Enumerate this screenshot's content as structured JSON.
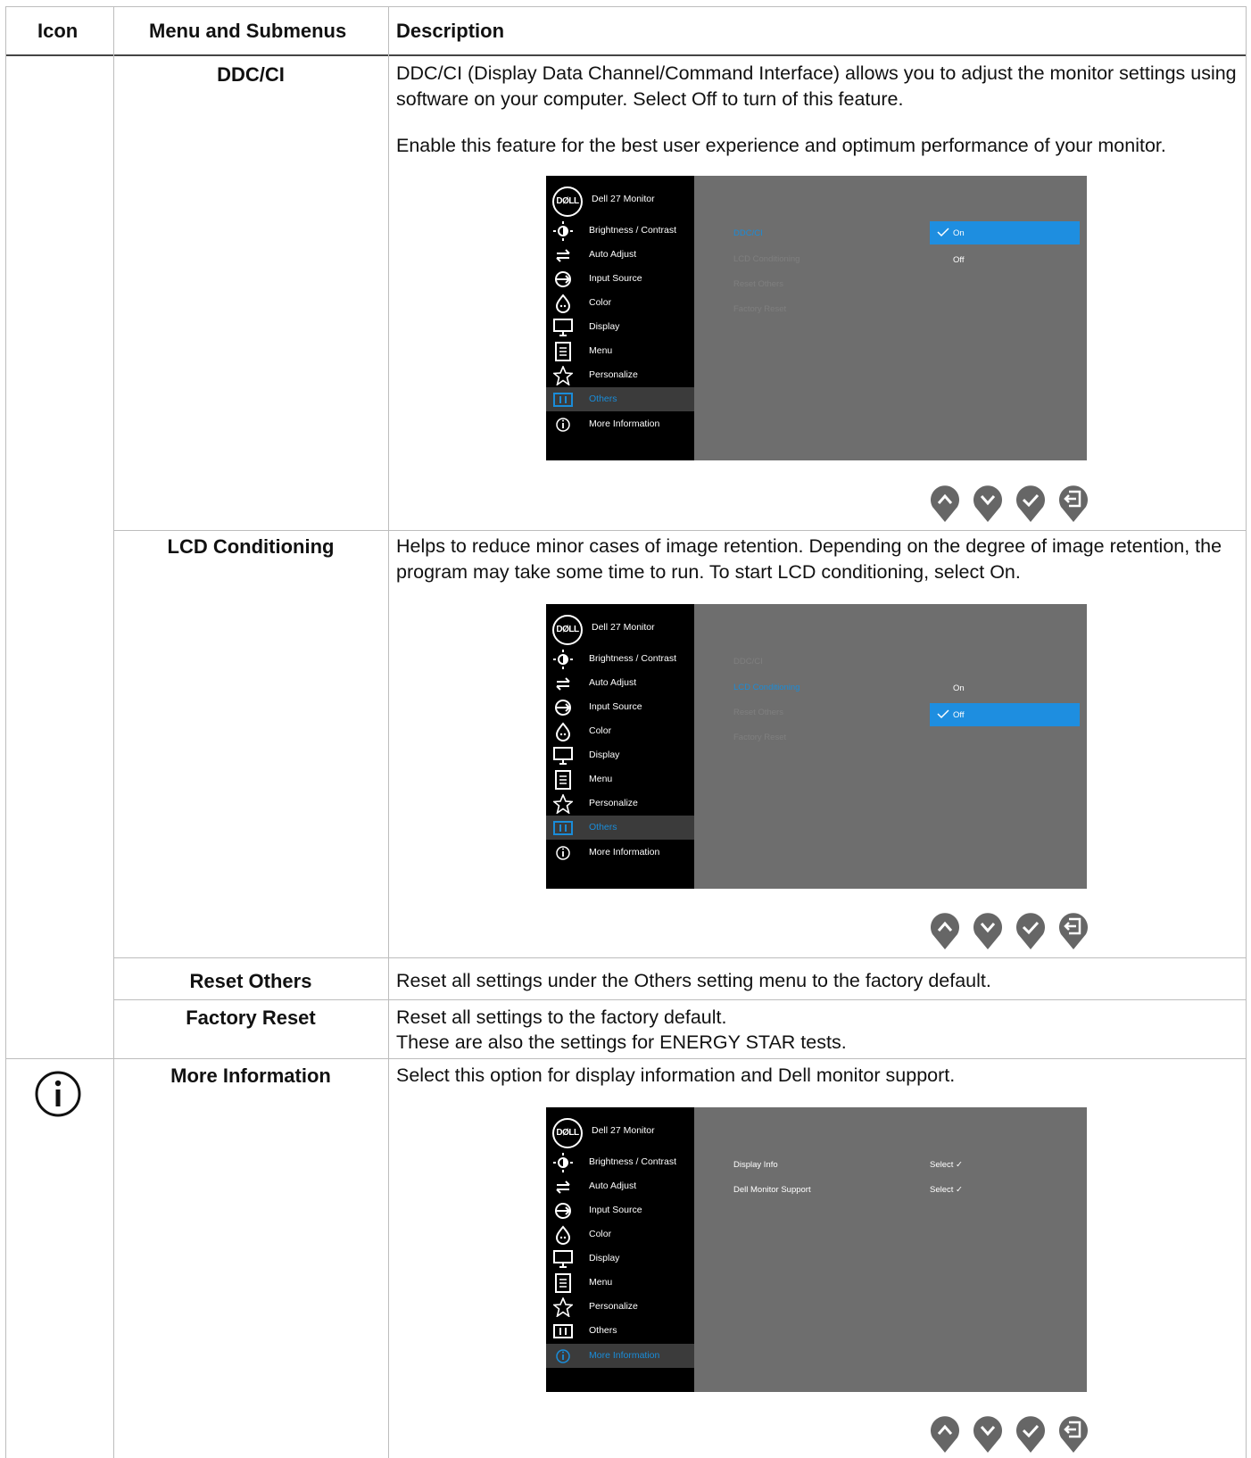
{
  "header": {
    "col_icon": "Icon",
    "col_menu": "Menu and Submenus",
    "col_desc": "Description"
  },
  "rows": {
    "ddcci": {
      "name": "DDC/CI",
      "desc1": "DDC/CI (Display Data Channel/Command Interface) allows you to adjust the monitor settings using software on your computer. Select Off to turn of this feature.",
      "desc2": "Enable this feature for the best user experience and optimum performance of your monitor."
    },
    "lcd": {
      "name": "LCD Conditioning",
      "desc1": "Helps to reduce minor cases of image retention. Depending on the degree of image retention, the program may take some time to run. To start LCD conditioning, select On."
    },
    "reset_others": {
      "name": "Reset Others",
      "desc1": "Reset all settings under the Others setting menu to the factory default."
    },
    "factory_reset": {
      "name": "Factory Reset",
      "desc1": "Reset all settings to the factory default.",
      "desc2": "These are also the settings for ENERGY STAR tests."
    },
    "more_info": {
      "name": "More Information",
      "desc1": "Select this option for display information and Dell monitor support."
    }
  },
  "osd": {
    "logo": "DØLL",
    "title": "Dell 27 Monitor",
    "menu": [
      "Brightness / Contrast",
      "Auto Adjust",
      "Input Source",
      "Color",
      "Display",
      "Menu",
      "Personalize",
      "Others",
      "More Information"
    ],
    "others_submenu": [
      "DDC/CI",
      "LCD Conditioning",
      "Reset Others",
      "Factory Reset"
    ],
    "on": "On",
    "off": "Off",
    "info_submenu": [
      "Display Info",
      "Dell Monitor Support"
    ],
    "select": "Select ✓"
  },
  "icons": {
    "more_info_row": "info-icon",
    "nav": [
      "up-icon",
      "down-icon",
      "check-icon",
      "back-icon"
    ]
  },
  "colors": {
    "osd_accent": "#1e8ee0",
    "osd_bg": "#6e6e6e",
    "nav": "#666666"
  }
}
